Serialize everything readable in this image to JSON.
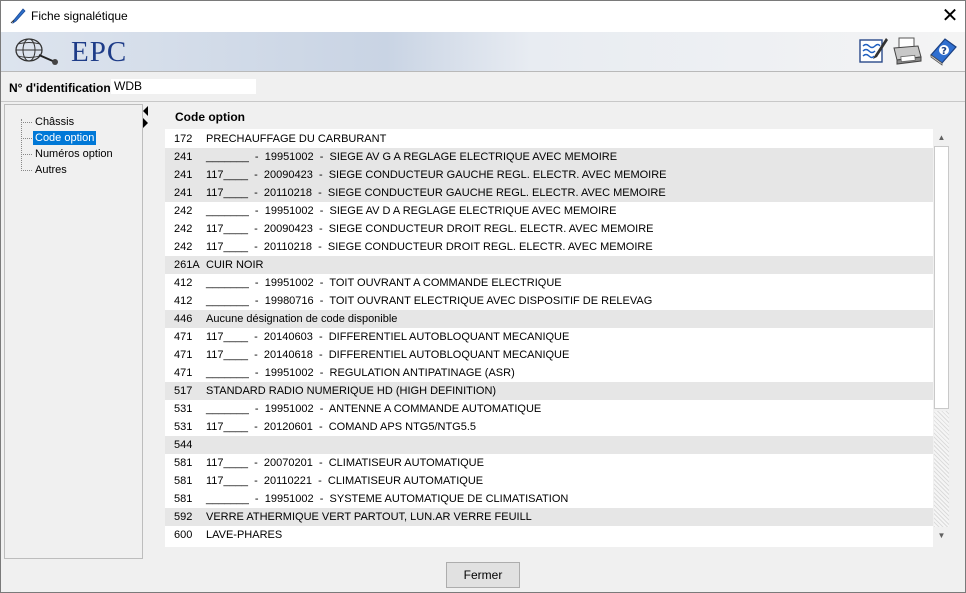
{
  "window": {
    "title": "Fiche signalétique"
  },
  "banner": {
    "brand": "EPC"
  },
  "identification": {
    "label": "N° d'identification",
    "value": "WDB"
  },
  "tree": {
    "items": [
      {
        "label": "Châssis"
      },
      {
        "label": "Code option",
        "selected": true
      },
      {
        "label": "Numéros option"
      },
      {
        "label": "Autres"
      }
    ]
  },
  "panel": {
    "header": "Code option",
    "rows": [
      {
        "code": "172",
        "desc": "PRECHAUFFAGE DU CARBURANT",
        "alt": false
      },
      {
        "code": "241",
        "desc": "_______  -  19951002  -  SIEGE AV G A REGLAGE ELECTRIQUE AVEC MEMOIRE",
        "alt": true
      },
      {
        "code": "241",
        "desc": "117____  -  20090423  -  SIEGE CONDUCTEUR GAUCHE REGL. ELECTR. AVEC MEMOIRE",
        "alt": true
      },
      {
        "code": "241",
        "desc": "117____  -  20110218  -  SIEGE CONDUCTEUR GAUCHE REGL. ELECTR. AVEC MEMOIRE",
        "alt": true
      },
      {
        "code": "242",
        "desc": "_______  -  19951002  -  SIEGE AV D A REGLAGE ELECTRIQUE AVEC MEMOIRE",
        "alt": false
      },
      {
        "code": "242",
        "desc": "117____  -  20090423  -  SIEGE CONDUCTEUR DROIT REGL. ELECTR. AVEC MEMOIRE",
        "alt": false
      },
      {
        "code": "242",
        "desc": "117____  -  20110218  -  SIEGE CONDUCTEUR DROIT REGL. ELECTR. AVEC MEMOIRE",
        "alt": false
      },
      {
        "code": "261A",
        "desc": "CUIR NOIR",
        "alt": true
      },
      {
        "code": "412",
        "desc": "_______  -  19951002  -  TOIT OUVRANT A COMMANDE ELECTRIQUE",
        "alt": false
      },
      {
        "code": "412",
        "desc": "_______  -  19980716  -  TOIT OUVRANT ELECTRIQUE AVEC DISPOSITIF DE RELEVAG",
        "alt": false
      },
      {
        "code": "446",
        "desc": "Aucune désignation de code disponible",
        "alt": true
      },
      {
        "code": "471",
        "desc": "117____  -  20140603  -  DIFFERENTIEL AUTOBLOQUANT MECANIQUE",
        "alt": false
      },
      {
        "code": "471",
        "desc": "117____  -  20140618  -  DIFFERENTIEL AUTOBLOQUANT MECANIQUE",
        "alt": false
      },
      {
        "code": "471",
        "desc": "_______  -  19951002  -  REGULATION ANTIPATINAGE (ASR)",
        "alt": false
      },
      {
        "code": "517",
        "desc": "STANDARD RADIO NUMERIQUE HD (HIGH DEFINITION)",
        "alt": true
      },
      {
        "code": "531",
        "desc": "_______  -  19951002  -  ANTENNE A COMMANDE AUTOMATIQUE",
        "alt": false
      },
      {
        "code": "531",
        "desc": "117____  -  20120601  -  COMAND APS NTG5/NTG5.5",
        "alt": false
      },
      {
        "code": "544",
        "desc": "",
        "alt": true
      },
      {
        "code": "581",
        "desc": "117____  -  20070201  -  CLIMATISEUR AUTOMATIQUE",
        "alt": false
      },
      {
        "code": "581",
        "desc": "117____  -  20110221  -  CLIMATISEUR AUTOMATIQUE",
        "alt": false
      },
      {
        "code": "581",
        "desc": "_______  -  19951002  -  SYSTEME AUTOMATIQUE DE CLIMATISATION",
        "alt": false
      },
      {
        "code": "592",
        "desc": "VERRE ATHERMIQUE VERT PARTOUT, LUN.AR VERRE FEUILL",
        "alt": true
      },
      {
        "code": "600",
        "desc": "LAVE-PHARES",
        "alt": false
      }
    ]
  },
  "buttons": {
    "close_label": "Fermer"
  },
  "icons": {
    "app": "feather-pen-icon",
    "close": "close-icon",
    "toolbar": [
      "edit-notes-icon",
      "printer-icon",
      "help-book-icon"
    ]
  },
  "colors": {
    "brand": "#1e3c88",
    "selection": "#0078d7",
    "alt_row": "#e6e6e6"
  }
}
